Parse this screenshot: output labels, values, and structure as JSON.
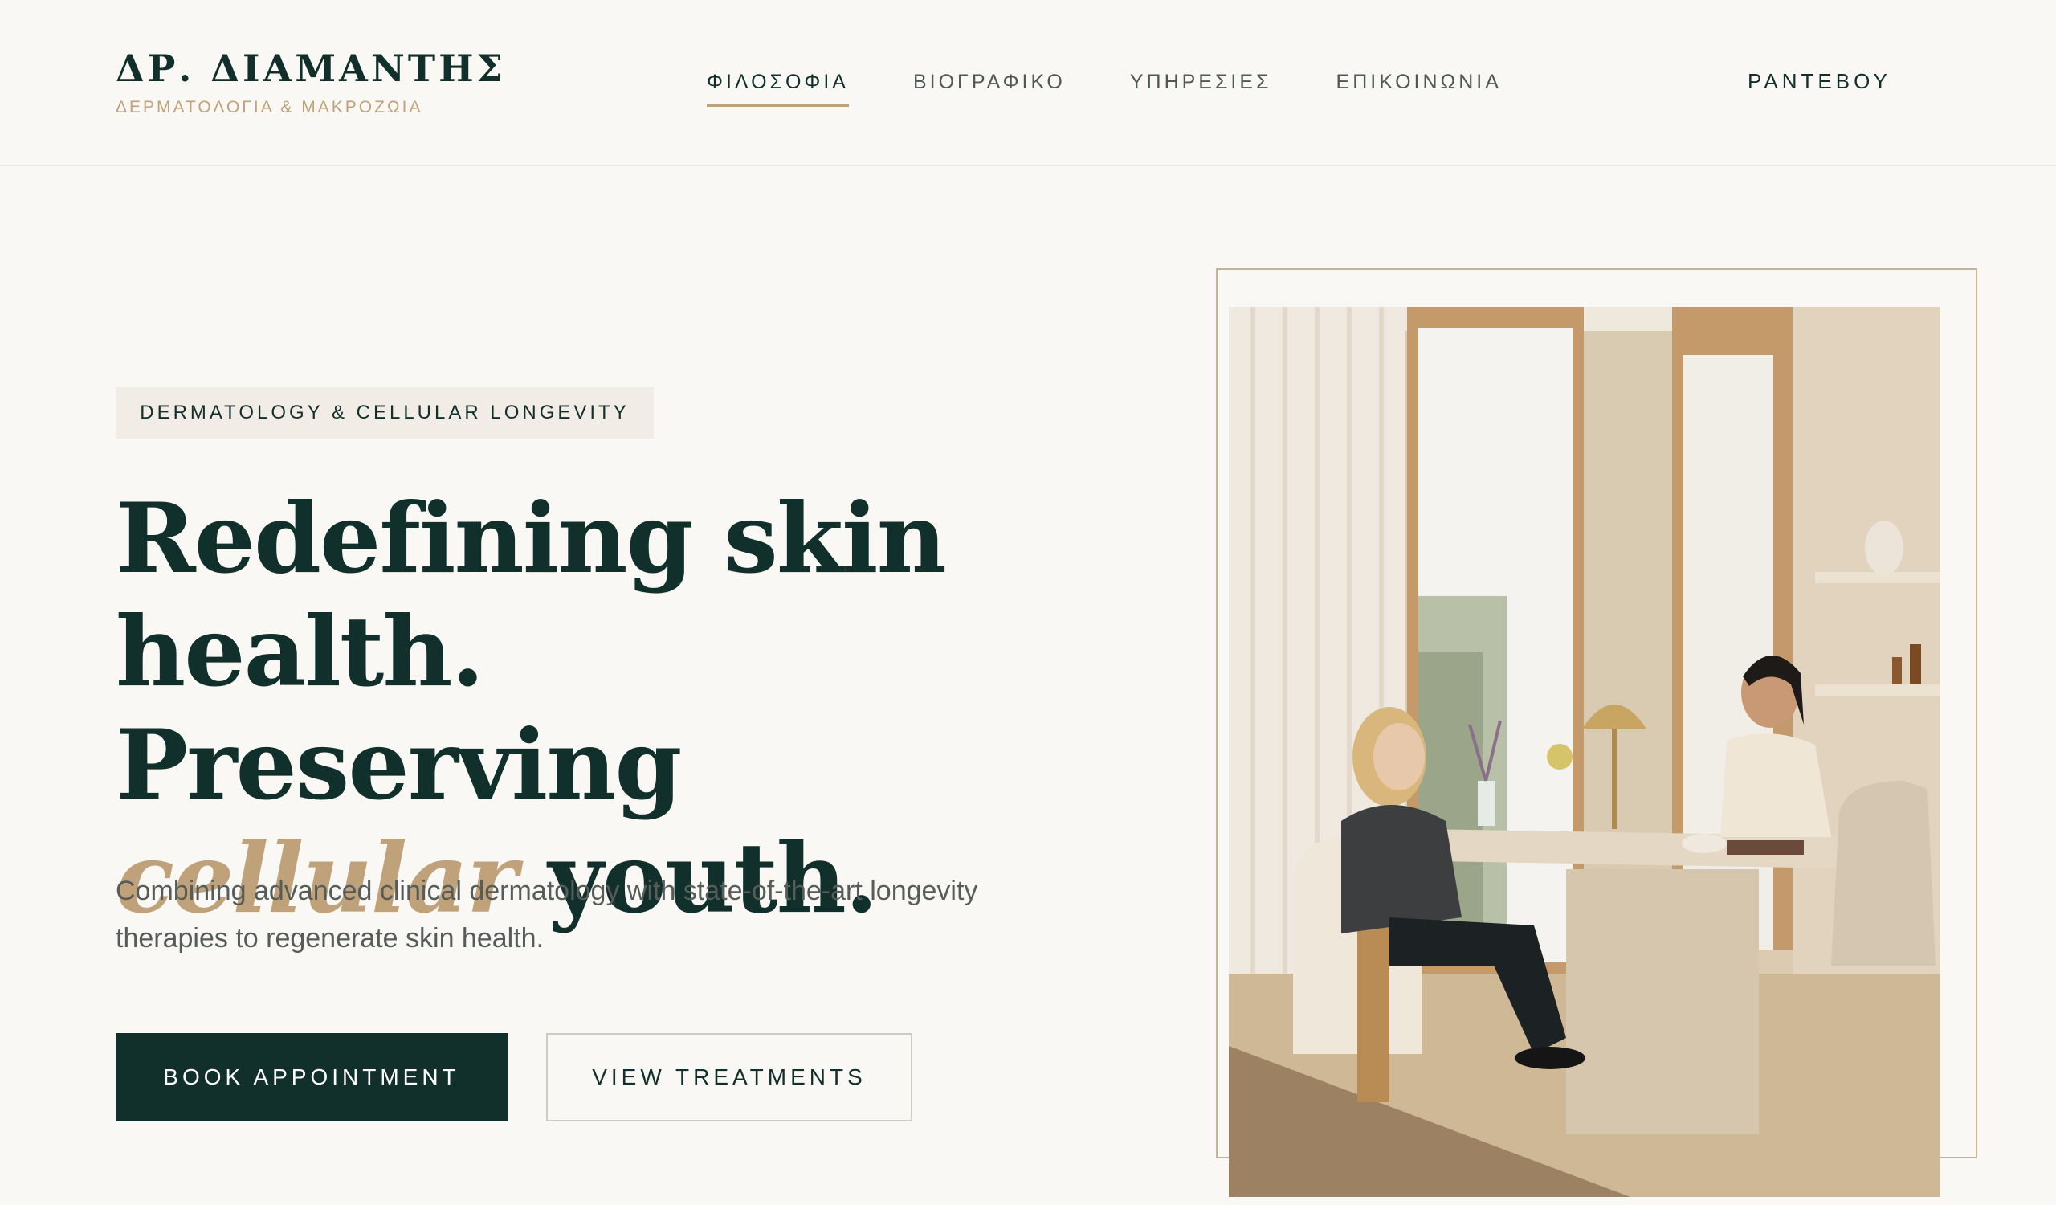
{
  "brand": {
    "name": "ΔΡ. ΔΙΑΜΑΝΤΗΣ",
    "subtitle": "ΔΕΡΜΑΤΟΛΟΓΙΑ & ΜΑΚΡΟΖΩΙΑ"
  },
  "nav": {
    "items": [
      {
        "label": "ΦΙΛΟΣΟΦΙΑ",
        "active": true
      },
      {
        "label": "ΒΙΟΓΡΑΦΙΚΟ",
        "active": false
      },
      {
        "label": "ΥΠΗΡΕΣΙΕΣ",
        "active": false
      },
      {
        "label": "ΕΠΙΚΟΙΝΩΝΙΑ",
        "active": false
      }
    ],
    "cta_label": "ΡΑΝΤΕΒΟΥ"
  },
  "hero": {
    "eyebrow": "DERMATOLOGY & CELLULAR LONGEVITY",
    "headline_line1": "Redefining skin",
    "headline_line2": "health. Preserving",
    "headline_accent": "cellular",
    "headline_line3_rest": " youth.",
    "lede": "Combining advanced clinical dermatology with state-of-the-art longevity therapies to regenerate skin health.",
    "primary_button": "BOOK APPOINTMENT",
    "secondary_button": "VIEW TREATMENTS"
  },
  "colors": {
    "background": "#faf8f5",
    "primary": "#12302b",
    "accent": "#c0a27a",
    "eyebrow_bg": "#f1ece5"
  }
}
